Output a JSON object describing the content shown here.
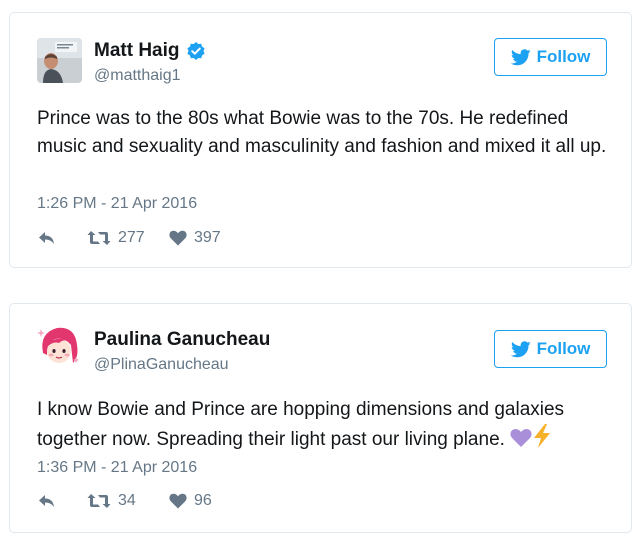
{
  "tweets": [
    {
      "name": "Matt Haig",
      "verified": true,
      "handle": "@matthaig1",
      "follow_label": "Follow",
      "text": "Prince was to the 80s what Bowie was to the 70s. He redefined music and sexuality and masculinity and fashion and mixed it all up.",
      "timestamp": "1:26 PM - 21 Apr 2016",
      "retweets": "277",
      "likes": "397",
      "avatar_icon": "person-photo"
    },
    {
      "name": "Paulina Ganucheau",
      "verified": false,
      "handle": "@PlinaGanucheau",
      "follow_label": "Follow",
      "text": "I know Bowie and Prince are hopping dimensions and galaxies together now. Spreading their light past our living plane.",
      "emojis": [
        "purple-heart",
        "lightning-bolt"
      ],
      "timestamp": "1:36 PM - 21 Apr 2016",
      "retweets": "34",
      "likes": "96",
      "avatar_icon": "pink-hair-illustration"
    }
  ],
  "colors": {
    "twitter_blue": "#1da1f2",
    "text": "#14171a",
    "muted": "#657786",
    "border": "#e1e8ed"
  }
}
